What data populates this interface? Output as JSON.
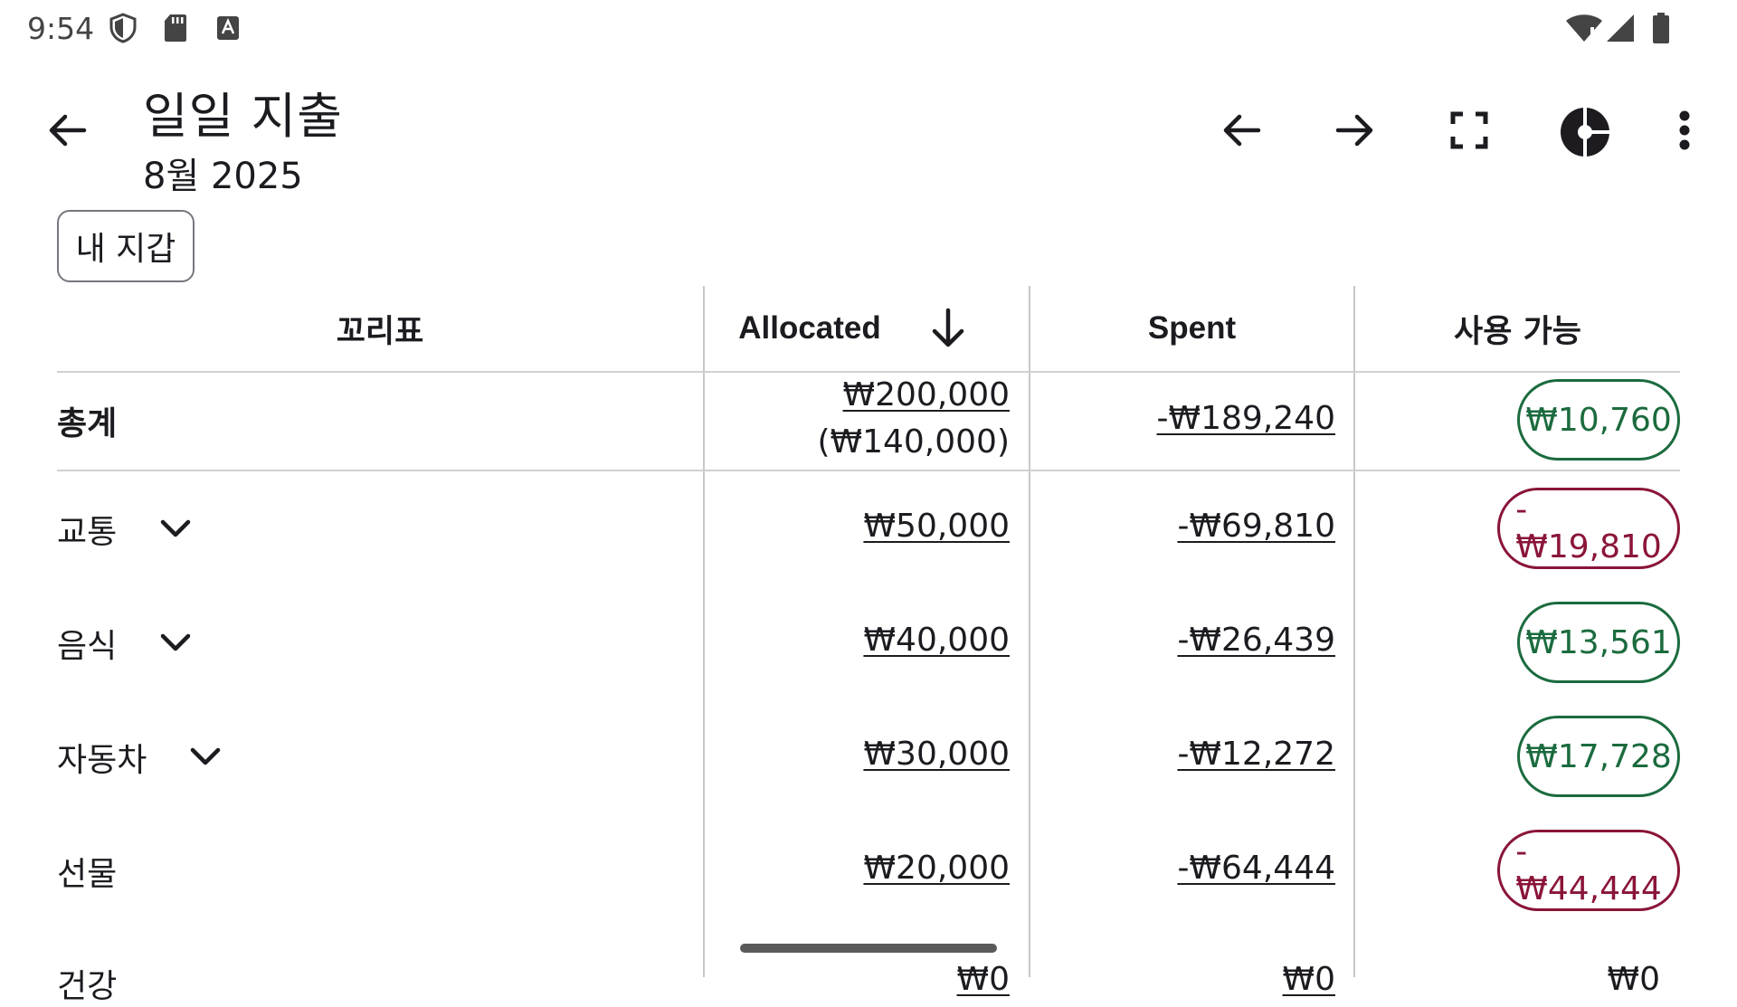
{
  "status_bar": {
    "time": "9:54",
    "icons": [
      "shield-icon",
      "sd-card-icon",
      "keyboard-a-icon",
      "wifi-icon",
      "cell-signal-icon",
      "battery-icon"
    ]
  },
  "app_bar": {
    "title": "일일 지출",
    "subtitle": "8월 2025",
    "icons": [
      "back-arrow-icon",
      "prev-arrow-icon",
      "next-arrow-icon",
      "fullscreen-icon",
      "pie-chart-icon",
      "more-vert-icon"
    ]
  },
  "chip": {
    "label": "내 지갑"
  },
  "table": {
    "headers": {
      "category": "꼬리표",
      "allocated": "Allocated",
      "spent": "Spent",
      "available": "사용 가능"
    },
    "sort_icon": "arrow-down-icon",
    "total": {
      "label": "총계",
      "allocated": "₩200,000",
      "allocated_sub": "(₩140,000)",
      "spent": "-₩189,240",
      "available": "₩10,760",
      "available_status": "positive"
    },
    "rows": [
      {
        "label": "교통",
        "expandable": true,
        "allocated": "₩50,000",
        "spent": "-₩69,810",
        "available": "-₩19,810",
        "available_status": "negative"
      },
      {
        "label": "음식",
        "expandable": true,
        "allocated": "₩40,000",
        "spent": "-₩26,439",
        "available": "₩13,561",
        "available_status": "positive"
      },
      {
        "label": "자동차",
        "expandable": true,
        "allocated": "₩30,000",
        "spent": "-₩12,272",
        "available": "₩17,728",
        "available_status": "positive"
      },
      {
        "label": "선물",
        "expandable": false,
        "allocated": "₩20,000",
        "spent": "-₩64,444",
        "available": "-₩44,444",
        "available_status": "negative"
      }
    ],
    "partial_row": {
      "label": "건강",
      "allocated": "₩0",
      "spent": "₩0",
      "available": "₩0"
    }
  },
  "colors": {
    "positive": "#1b6b3e",
    "negative": "#8a1538",
    "divider": "#d0d0d0"
  }
}
